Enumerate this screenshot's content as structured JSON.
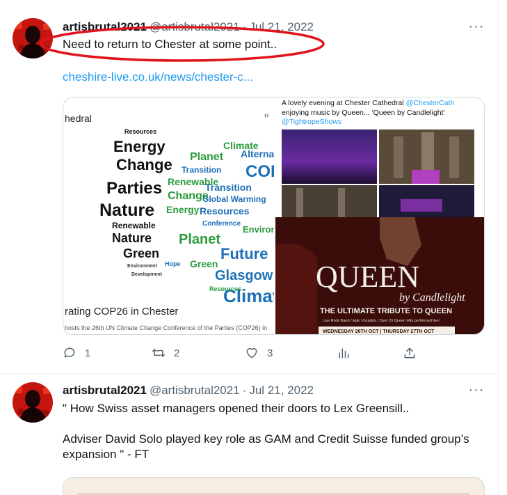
{
  "tweets": [
    {
      "display_name": "artisbrutal2021",
      "handle": "@artisbrutal2021",
      "separator": "·",
      "date": "Jul 21, 2022",
      "text": "Need to return to Chester at some point..",
      "link": "cheshire-live.co.uk/news/chester-c...",
      "media": {
        "left": {
          "header_text": "hedral",
          "header_text_right": "H",
          "caption": "rating COP26 in Chester",
          "subcaption": "hosts the 26th UN Climate Change Conference of the Parties (COP26) in"
        },
        "right": {
          "line1": "A lovely evening at Chester Cathedral",
          "line1_mention": "@ChesterCath",
          "line2": "enjoying music by Queen...  'Queen by Candlelight'",
          "line3_mention": "@TightropeShows",
          "poster_title": "QUEEN",
          "poster_subtitle": "by Candlelight",
          "poster_tagline": "THE ULTIMATE TRIBUTE TO QUEEN",
          "poster_small": "Live Rock Band / Epic Vocalists / Over 20 Queen Hits performed live!",
          "poster_dates": "WEDNESDAY 26TH OCT  |  THURSDAY 27TH OCT"
        }
      },
      "actions": {
        "reply_count": "1",
        "retweet_count": "2",
        "like_count": "3"
      }
    },
    {
      "display_name": "artisbrutal2021",
      "handle": "@artisbrutal2021",
      "separator": "·",
      "date": "Jul 21, 2022",
      "text": "\" How Swiss asset managers opened their doors to Lex Greensill..\n\nAdviser David Solo played key role as GAM and Credit Suisse funded group’s expansion \" - FT"
    }
  ],
  "more_label": "···",
  "colors": {
    "accent_link": "#1d9bf0",
    "secondary_text": "#536471",
    "highlight_oval": "#e0141c"
  },
  "word_cloud": [
    "Resources",
    "Energy",
    "Change",
    "Parties",
    "Nature",
    "Renewable",
    "Nature",
    "Green",
    "Climate",
    "Alternat",
    "COP",
    "Planet",
    "Transition",
    "Renewable",
    "Change",
    "Global Warming",
    "Energy",
    "Resources",
    "Conference",
    "Planet",
    "Future",
    "Green",
    "Glasgow",
    "Climate",
    "Environment",
    "Hope"
  ]
}
